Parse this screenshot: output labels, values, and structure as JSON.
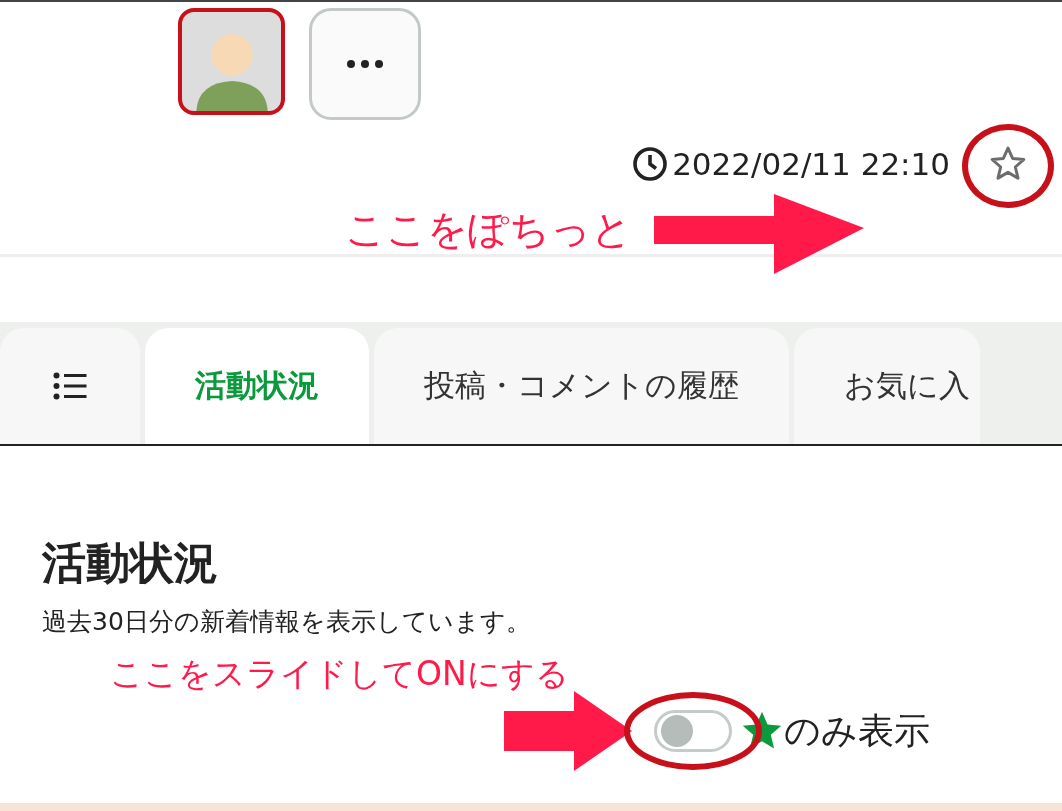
{
  "header": {
    "timestamp": "2022/02/11 22:10",
    "favorite": {
      "on": false
    }
  },
  "annotations": [
    {
      "text": "ここをぽちっと"
    },
    {
      "text": "ここをスライドしてONにする"
    }
  ],
  "tabs": [
    {
      "kind": "icon",
      "selected": false
    },
    {
      "kind": "text",
      "label": "活動状況",
      "selected": true
    },
    {
      "kind": "text",
      "label": "投稿・コメントの履歴",
      "selected": false
    },
    {
      "kind": "text",
      "label": "お気に入",
      "selected": false
    }
  ],
  "section": {
    "title": "活動状況",
    "description": "過去30日分の新着情報を表示しています。",
    "filter": {
      "on": false,
      "label": "のみ表示"
    }
  }
}
